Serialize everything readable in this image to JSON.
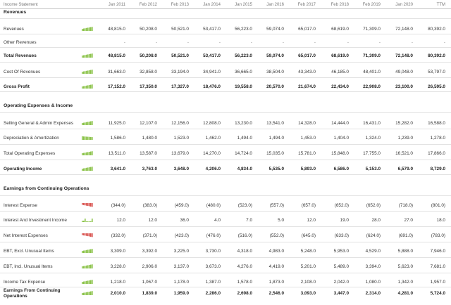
{
  "header": {
    "label": "Income Statement",
    "periods": [
      "Jan 2011",
      "Feb 2012",
      "Feb 2013",
      "Jan 2014",
      "Jan 2015",
      "Jan 2016",
      "Feb 2017",
      "Feb 2018",
      "Feb 2019",
      "Jan 2020",
      "TTM"
    ]
  },
  "sections": {
    "revenues": "Revenues",
    "opex": "Operating Expenses & Income",
    "ecop": "Earnings from Continuing Operations"
  },
  "rows": [
    {
      "label": "Revenues",
      "bold": false,
      "spark": "up",
      "values": [
        "48,815.0",
        "50,208.0",
        "50,521.0",
        "53,417.0",
        "56,223.0",
        "59,074.0",
        "65,017.0",
        "68,619.0",
        "71,309.0",
        "72,148.0",
        "80,392.0"
      ]
    },
    {
      "label": "Other Revenues",
      "bold": false,
      "spark": "none",
      "values": [
        "-",
        "-",
        "-",
        "-",
        "-",
        "-",
        "-",
        "-",
        "-",
        "-",
        "-"
      ]
    },
    {
      "label": "Total Revenues",
      "bold": true,
      "spark": "up",
      "values": [
        "48,815.0",
        "50,208.0",
        "50,521.0",
        "53,417.0",
        "56,223.0",
        "59,074.0",
        "65,017.0",
        "68,619.0",
        "71,309.0",
        "72,148.0",
        "80,392.0"
      ]
    },
    {
      "label": "Cost Of Revenues",
      "bold": false,
      "spark": "up",
      "values": [
        "31,663.0",
        "32,858.0",
        "33,194.0",
        "34,941.0",
        "36,665.0",
        "38,504.0",
        "43,343.0",
        "46,185.0",
        "48,401.0",
        "49,048.0",
        "53,797.0"
      ]
    },
    {
      "label": "Gross Profit",
      "bold": true,
      "spark": "up",
      "values": [
        "17,152.0",
        "17,350.0",
        "17,327.0",
        "18,476.0",
        "19,558.0",
        "20,570.0",
        "21,674.0",
        "22,434.0",
        "22,908.0",
        "23,100.0",
        "26,595.0"
      ]
    },
    {
      "label": "Selling General & Admin Expenses",
      "bold": false,
      "spark": "up",
      "values": [
        "11,925.0",
        "12,107.0",
        "12,156.0",
        "12,808.0",
        "13,230.0",
        "13,541.0",
        "14,328.0",
        "14,444.0",
        "16,431.0",
        "15,282.0",
        "16,588.0"
      ]
    },
    {
      "label": "Depreciation & Amortization",
      "bold": false,
      "spark": "flat",
      "values": [
        "1,586.0",
        "1,480.0",
        "1,523.0",
        "1,462.0",
        "1,494.0",
        "1,494.0",
        "1,453.0",
        "1,404.0",
        "1,324.0",
        "1,239.0",
        "1,278.0"
      ]
    },
    {
      "label": "Total Operating Expenses",
      "bold": false,
      "spark": "up",
      "values": [
        "13,511.0",
        "13,587.0",
        "13,679.0",
        "14,270.0",
        "14,724.0",
        "15,035.0",
        "15,781.0",
        "15,848.0",
        "17,755.0",
        "16,521.0",
        "17,866.0"
      ]
    },
    {
      "label": "Operating Income",
      "bold": true,
      "spark": "up",
      "values": [
        "3,641.0",
        "3,763.0",
        "3,648.0",
        "4,206.0",
        "4,834.0",
        "5,535.0",
        "5,893.0",
        "6,586.0",
        "5,153.0",
        "6,579.0",
        "8,729.0"
      ]
    },
    {
      "label": "Interest Expense",
      "bold": false,
      "spark": "red",
      "values": [
        "(344.0)",
        "(383.0)",
        "(459.0)",
        "(480.0)",
        "(523.0)",
        "(557.0)",
        "(657.0)",
        "(652.0)",
        "(652.0)",
        "(718.0)",
        "(801.0)"
      ]
    },
    {
      "label": "Interest And Investment Income",
      "bold": false,
      "spark": "sparse",
      "values": [
        "12.0",
        "12.0",
        "36.0",
        "4.0",
        "7.0",
        "5.0",
        "12.0",
        "19.0",
        "28.0",
        "27.0",
        "18.0"
      ]
    },
    {
      "label": "Net Interest Expenses",
      "bold": false,
      "spark": "red",
      "values": [
        "(332.0)",
        "(371.0)",
        "(423.0)",
        "(476.0)",
        "(516.0)",
        "(552.0)",
        "(645.0)",
        "(633.0)",
        "(624.0)",
        "(691.0)",
        "(783.0)"
      ]
    },
    {
      "label": "EBT, Excl. Unusual Items",
      "bold": false,
      "spark": "up",
      "values": [
        "3,309.0",
        "3,392.0",
        "3,225.0",
        "3,730.0",
        "4,318.0",
        "4,983.0",
        "5,248.0",
        "5,953.0",
        "4,529.0",
        "5,888.0",
        "7,946.0"
      ]
    },
    {
      "label": "EBT, Incl. Unusual Items",
      "bold": false,
      "spark": "up",
      "values": [
        "3,228.0",
        "2,906.0",
        "3,137.0",
        "3,673.0",
        "4,276.0",
        "4,419.0",
        "5,201.0",
        "5,489.0",
        "3,394.0",
        "5,623.0",
        "7,681.0"
      ]
    },
    {
      "label": "Income Tax Expense",
      "bold": false,
      "spark": "up",
      "values": [
        "1,218.0",
        "1,067.0",
        "1,178.0",
        "1,387.0",
        "1,578.0",
        "1,873.0",
        "2,108.0",
        "2,042.0",
        "1,080.0",
        "1,342.0",
        "1,957.0"
      ]
    },
    {
      "label": "Earnings From Continuing Operations",
      "bold": true,
      "spark": "up",
      "values": [
        "2,010.0",
        "1,839.0",
        "1,959.0",
        "2,286.0",
        "2,698.0",
        "2,546.0",
        "3,093.0",
        "3,447.0",
        "2,314.0",
        "4,281.0",
        "5,724.0"
      ]
    }
  ],
  "colors": {
    "spark_green": "#8bc34a",
    "spark_red": "#d9534f"
  }
}
